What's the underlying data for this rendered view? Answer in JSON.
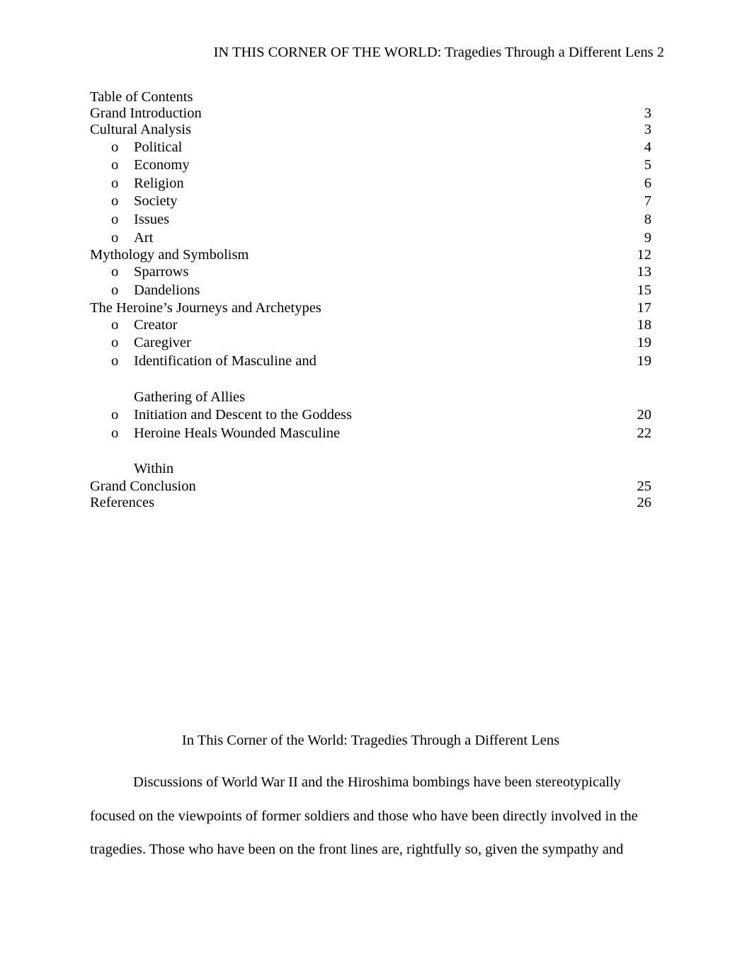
{
  "header": {
    "running_head": "IN THIS CORNER OF THE WORLD: Tragedies Through a Different Lens 2"
  },
  "toc": {
    "heading": "Table of Contents",
    "entries": [
      {
        "level": 1,
        "label": "Grand Introduction",
        "page": "3"
      },
      {
        "level": 1,
        "label": "Cultural Analysis",
        "page": "3"
      },
      {
        "level": 2,
        "bullet": "o",
        "label": "Political",
        "page": "4"
      },
      {
        "level": 2,
        "bullet": "o",
        "label": "Economy",
        "page": "5"
      },
      {
        "level": 2,
        "bullet": "o",
        "label": "Religion",
        "page": "6"
      },
      {
        "level": 2,
        "bullet": "o",
        "label": "Society",
        "page": "7"
      },
      {
        "level": 2,
        "bullet": "o",
        "label": "Issues",
        "page": "8"
      },
      {
        "level": 2,
        "bullet": "o",
        "label": "Art",
        "page": "9"
      },
      {
        "level": 1,
        "label": "Mythology and Symbolism",
        "page": "12"
      },
      {
        "level": 2,
        "bullet": "o",
        "label": "Sparrows",
        "page": "13"
      },
      {
        "level": 2,
        "bullet": "o",
        "label": "Dandelions",
        "page": "15"
      },
      {
        "level": 1,
        "label": "The Heroine’s Journeys and Archetypes",
        "page": "17"
      },
      {
        "level": 2,
        "bullet": "o",
        "label": "Creator",
        "page": "18"
      },
      {
        "level": 2,
        "bullet": "o",
        "label": "Caregiver",
        "page": "19"
      },
      {
        "level": 2,
        "bullet": "o",
        "label": "Identification of Masculine and",
        "page": "19"
      },
      {
        "level": 0,
        "label": "",
        "page": ""
      },
      {
        "level": 3,
        "label": "Gathering of Allies",
        "page": ""
      },
      {
        "level": 2,
        "bullet": "o",
        "label": "Initiation and Descent to the Goddess",
        "page": "20"
      },
      {
        "level": 2,
        "bullet": "o",
        "label": "Heroine Heals Wounded Masculine",
        "page": "22"
      },
      {
        "level": 0,
        "label": "",
        "page": ""
      },
      {
        "level": 3,
        "label": "Within",
        "page": ""
      },
      {
        "level": 1,
        "label": "Grand Conclusion",
        "page": "25"
      },
      {
        "level": 1,
        "label": "References",
        "page": "26"
      }
    ]
  },
  "body": {
    "title": "In This Corner of the World: Tragedies Through a Different Lens",
    "paragraph": "Discussions of World War II and the Hiroshima bombings have been stereotypically focused on the viewpoints of former soldiers and those who have been directly involved in the tragedies. Those who have been on the front lines are, rightfully so, given the sympathy and"
  }
}
